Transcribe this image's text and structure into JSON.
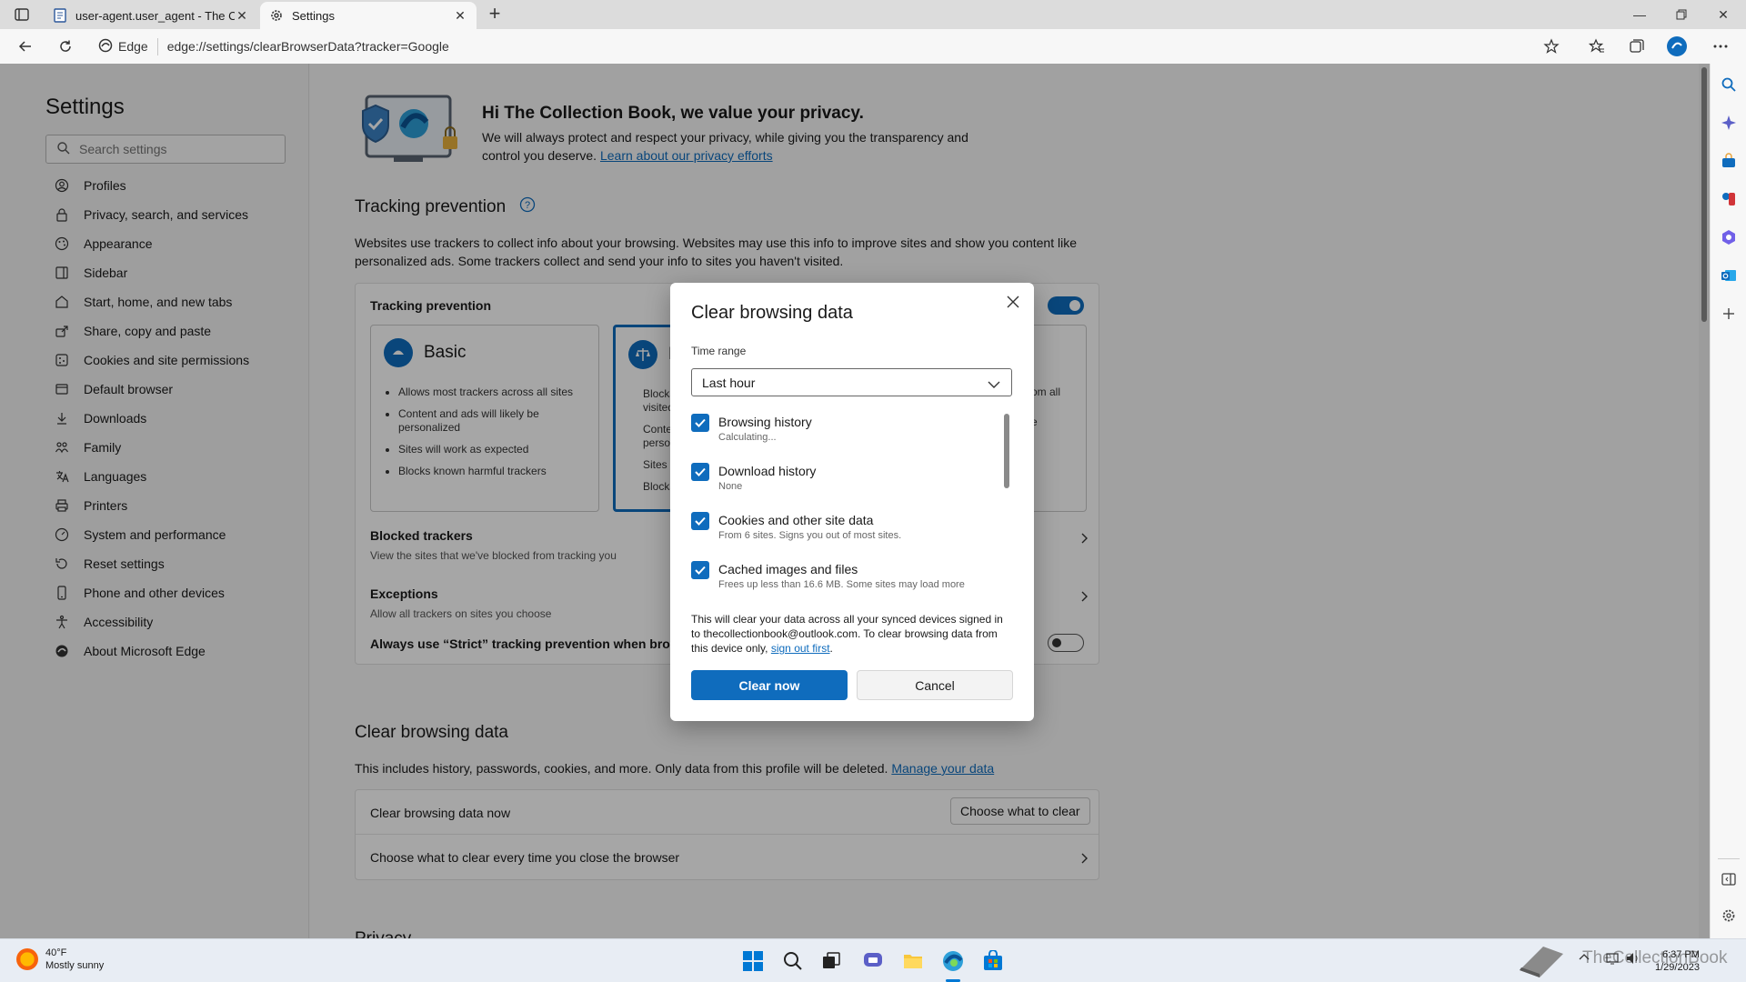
{
  "browser": {
    "tabs": [
      {
        "title": "user-agent.user_agent - The Coll",
        "icon": "document-icon"
      },
      {
        "title": "Settings",
        "icon": "gear-icon"
      }
    ],
    "address_chip": "Edge",
    "url": "edge://settings/clearBrowserData?tracker=Google"
  },
  "sidebar": {
    "title": "Settings",
    "search_placeholder": "Search settings",
    "items": [
      {
        "label": "Profiles",
        "icon": "profile-icon"
      },
      {
        "label": "Privacy, search, and services",
        "icon": "lock-icon"
      },
      {
        "label": "Appearance",
        "icon": "palette-icon"
      },
      {
        "label": "Sidebar",
        "icon": "sidebar-icon"
      },
      {
        "label": "Start, home, and new tabs",
        "icon": "home-icon"
      },
      {
        "label": "Share, copy and paste",
        "icon": "share-icon"
      },
      {
        "label": "Cookies and site permissions",
        "icon": "cookie-icon"
      },
      {
        "label": "Default browser",
        "icon": "browser-icon"
      },
      {
        "label": "Downloads",
        "icon": "download-icon"
      },
      {
        "label": "Family",
        "icon": "family-icon"
      },
      {
        "label": "Languages",
        "icon": "language-icon"
      },
      {
        "label": "Printers",
        "icon": "printer-icon"
      },
      {
        "label": "System and performance",
        "icon": "system-icon"
      },
      {
        "label": "Reset settings",
        "icon": "reset-icon"
      },
      {
        "label": "Phone and other devices",
        "icon": "phone-icon"
      },
      {
        "label": "Accessibility",
        "icon": "accessibility-icon"
      },
      {
        "label": "About Microsoft Edge",
        "icon": "edge-icon"
      }
    ]
  },
  "main": {
    "hero_title": "Hi The Collection Book, we value your privacy.",
    "hero_text": "We will always protect and respect your privacy, while giving you the transparency and control you deserve.",
    "hero_link": "Learn about our privacy efforts",
    "tracking": {
      "title": "Tracking prevention",
      "description": "Websites use trackers to collect info about your browsing. Websites may use this info to improve sites and show you content like personalized ads. Some trackers collect and send your info to sites you haven't visited.",
      "card_label": "Tracking prevention",
      "toggle_on": true,
      "basic": {
        "name": "Basic",
        "bullets": [
          "Allows most trackers across all sites",
          "Content and ads will likely be personalized",
          "Sites will work as expected",
          "Blocks known harmful trackers"
        ]
      },
      "balanced_partial": {
        "name": "B",
        "bullets": [
          "Blocks",
          "visited",
          "Conte",
          "perso",
          "Sites w",
          "Blocks"
        ]
      },
      "strict_partial": {
        "bullets": [
          "om all",
          "e"
        ]
      },
      "blocked_title": "Blocked trackers",
      "blocked_sub": "View the sites that we've blocked from tracking you",
      "exceptions_title": "Exceptions",
      "exceptions_sub": "Allow all trackers on sites you choose",
      "strict_inprivate": "Always use “Strict” tracking prevention when browsi",
      "strict_toggle_on": false
    },
    "clear": {
      "title": "Clear browsing data",
      "text": "This includes history, passwords, cookies, and more. Only data from this profile will be deleted.",
      "link": "Manage your data",
      "row1": "Clear browsing data now",
      "row1_button": "Choose what to clear",
      "row2": "Choose what to clear every time you close the browser"
    },
    "next_section": "Privacy"
  },
  "dialog": {
    "title": "Clear browsing data",
    "time_range_label": "Time range",
    "time_range_value": "Last hour",
    "items": [
      {
        "title": "Browsing history",
        "sub": "Calculating...",
        "checked": true
      },
      {
        "title": "Download history",
        "sub": "None",
        "checked": true
      },
      {
        "title": "Cookies and other site data",
        "sub": "From 6 sites. Signs you out of most sites.",
        "checked": true
      },
      {
        "title": "Cached images and files",
        "sub": "Frees up less than 16.6 MB. Some sites may load more",
        "checked": true
      }
    ],
    "note": "This will clear your data across all your synced devices signed in to thecollectionbook@outlook.com. To clear browsing data from this device only,",
    "note_link": "sign out first",
    "note_end": ".",
    "clear_button": "Clear now",
    "cancel_button": "Cancel"
  },
  "taskbar": {
    "temp": "40°F",
    "condition": "Mostly sunny",
    "time": "6:37 PM",
    "date": "1/29/2023",
    "watermark": "TheCollectionBook"
  },
  "colors": {
    "accent": "#0f6cbd"
  }
}
